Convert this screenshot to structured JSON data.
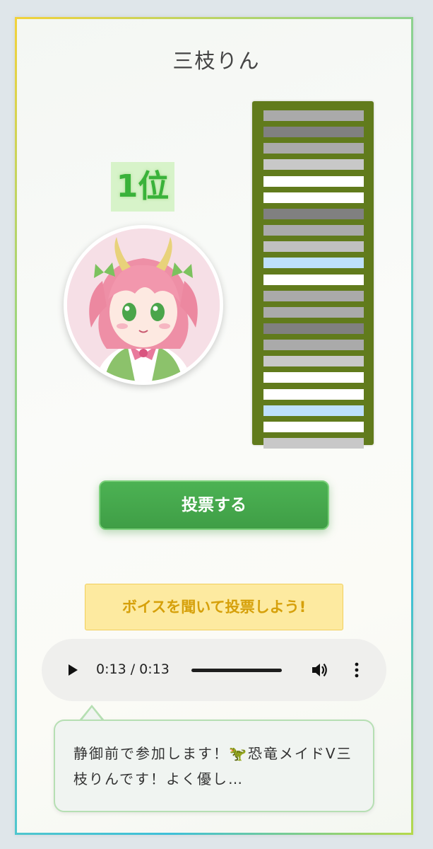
{
  "candidate": {
    "name": "三枝りん",
    "rank": "1位"
  },
  "bar_panel": {
    "background": "#617b1c",
    "bar_colors": [
      "#aaaaaa",
      "#808080",
      "#aaaaaa",
      "#c8c8c8",
      "#ffffff",
      "#ffffff",
      "#808080",
      "#aaaaaa",
      "#c0c0c0",
      "#bde0fb",
      "#ffffff",
      "#aaaaaa",
      "#aaaaaa",
      "#808080",
      "#aaaaaa",
      "#c8c8c8",
      "#ffffff",
      "#ffffff",
      "#bde0fb",
      "#ffffff",
      "#c8c8c8"
    ]
  },
  "actions": {
    "vote_label": "投票する",
    "hint": "ボイスを聞いて投票しよう!"
  },
  "audio": {
    "time_display": "0:13 / 0:13",
    "progress_percent": 100
  },
  "comment": {
    "text": "静御前で参加します！🦖恐竜メイドV三枝りんです！よく優し…"
  },
  "colors": {
    "accent_green": "#3f9e46",
    "rank_green": "#3ab23a",
    "hint_yellow": "#fdeaa0"
  }
}
